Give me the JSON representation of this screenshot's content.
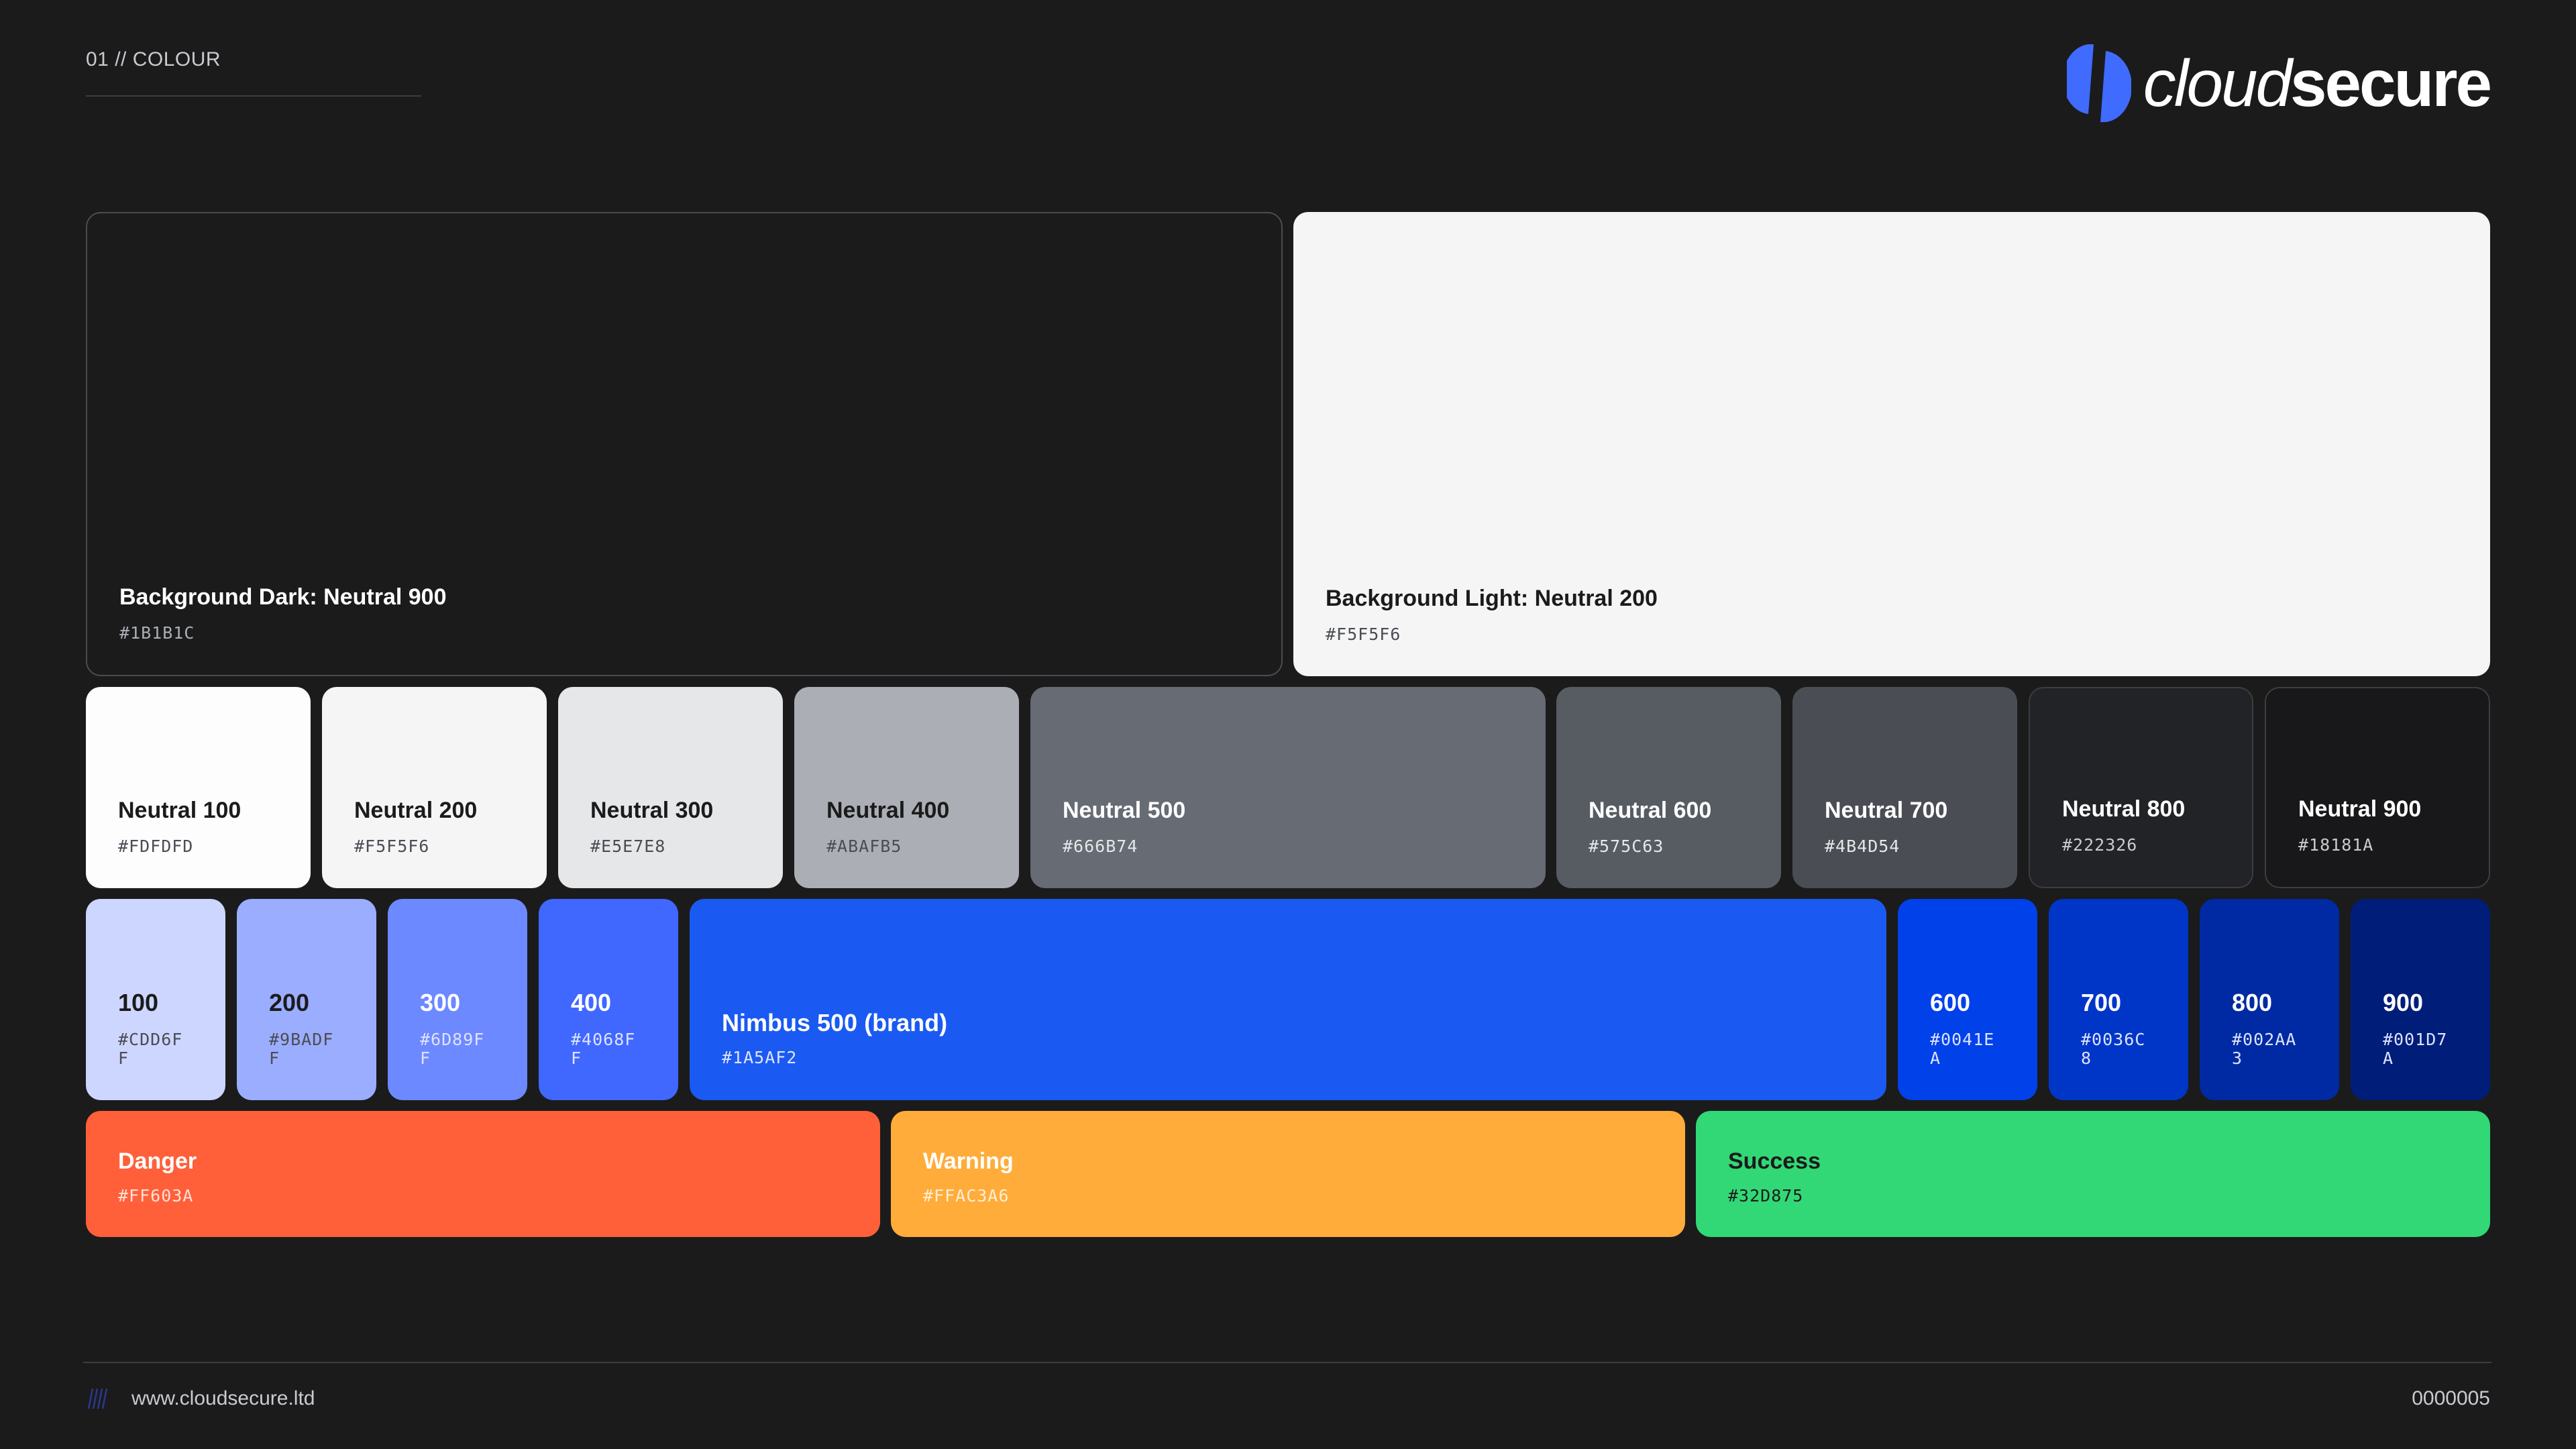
{
  "header": {
    "section_label": "01 // COLOUR",
    "logo_light": "cloud",
    "logo_bold": "secure",
    "logo_icon": "cloudsecure-logo-icon",
    "brand_color": "#406BFF"
  },
  "backgrounds": {
    "dark": {
      "name": "Background Dark: Neutral 900",
      "hex": "#1B1B1C"
    },
    "light": {
      "name": "Background Light: Neutral 200",
      "hex": "#F5F5F6"
    }
  },
  "neutrals": [
    {
      "name": "Neutral 100",
      "hex": "#FDFDFD"
    },
    {
      "name": "Neutral 200",
      "hex": "#F5F5F6"
    },
    {
      "name": "Neutral 300",
      "hex": "#E5E7E8"
    },
    {
      "name": "Neutral 400",
      "hex": "#ABAFB5"
    },
    {
      "name": "Neutral 500",
      "hex": "#666B74"
    },
    {
      "name": "Neutral 600",
      "hex": "#575C63"
    },
    {
      "name": "Neutral 700",
      "hex": "#4B4D54"
    },
    {
      "name": "Neutral 800",
      "hex": "#222326"
    },
    {
      "name": "Neutral 900",
      "hex": "#18181A"
    }
  ],
  "nimbus": [
    {
      "name": "100",
      "hex": "#CDD6FF"
    },
    {
      "name": "200",
      "hex": "#9BADFF"
    },
    {
      "name": "300",
      "hex": "#6D89FF"
    },
    {
      "name": "400",
      "hex": "#4068FF"
    },
    {
      "name": "Nimbus 500 (brand)",
      "hex": "#1A5AF2"
    },
    {
      "name": "600",
      "hex": "#0041EA"
    },
    {
      "name": "700",
      "hex": "#0036C8"
    },
    {
      "name": "800",
      "hex": "#002AA3"
    },
    {
      "name": "900",
      "hex": "#001D7A"
    }
  ],
  "status": [
    {
      "name": "Danger",
      "hex": "#FF603A"
    },
    {
      "name": "Warning",
      "hex": "#FFAC3A6"
    },
    {
      "name": "Success",
      "hex": "#32D875"
    }
  ],
  "footer": {
    "url": "www.cloudsecure.ltd",
    "page_number": "0000005"
  }
}
